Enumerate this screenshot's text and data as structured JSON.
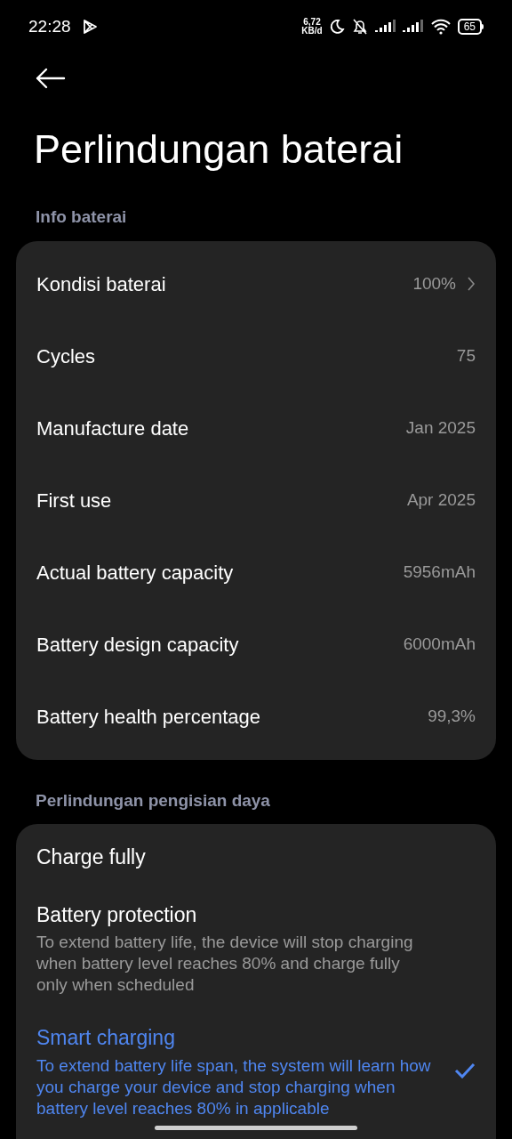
{
  "status_bar": {
    "time": "22:28",
    "net_speed": "6,72",
    "net_unit": "KB/d",
    "battery": "65"
  },
  "title": "Perlindungan baterai",
  "info_section": {
    "label": "Info baterai",
    "rows": [
      {
        "label": "Kondisi baterai",
        "value": "100%",
        "chevron": true
      },
      {
        "label": "Cycles",
        "value": "75",
        "chevron": false
      },
      {
        "label": "Manufacture date",
        "value": "Jan 2025",
        "chevron": false
      },
      {
        "label": "First use",
        "value": "Apr 2025",
        "chevron": false
      },
      {
        "label": "Actual battery capacity",
        "value": "5956mAh",
        "chevron": false
      },
      {
        "label": "Battery design capacity",
        "value": "6000mAh",
        "chevron": false
      },
      {
        "label": "Battery health percentage",
        "value": "99,3%",
        "chevron": false
      }
    ]
  },
  "charging_section": {
    "label": "Perlindungan pengisian daya",
    "options": [
      {
        "title": "Charge fully",
        "selected": false
      },
      {
        "title": "Battery protection",
        "description": "To extend battery life, the device will stop charging when battery level reaches 80% and charge fully only when scheduled",
        "selected": false
      },
      {
        "title": "Smart charging",
        "description": "To extend battery life span, the system will learn how you charge your device and stop charging when battery level reaches 80% in applicable",
        "selected": true
      }
    ]
  }
}
